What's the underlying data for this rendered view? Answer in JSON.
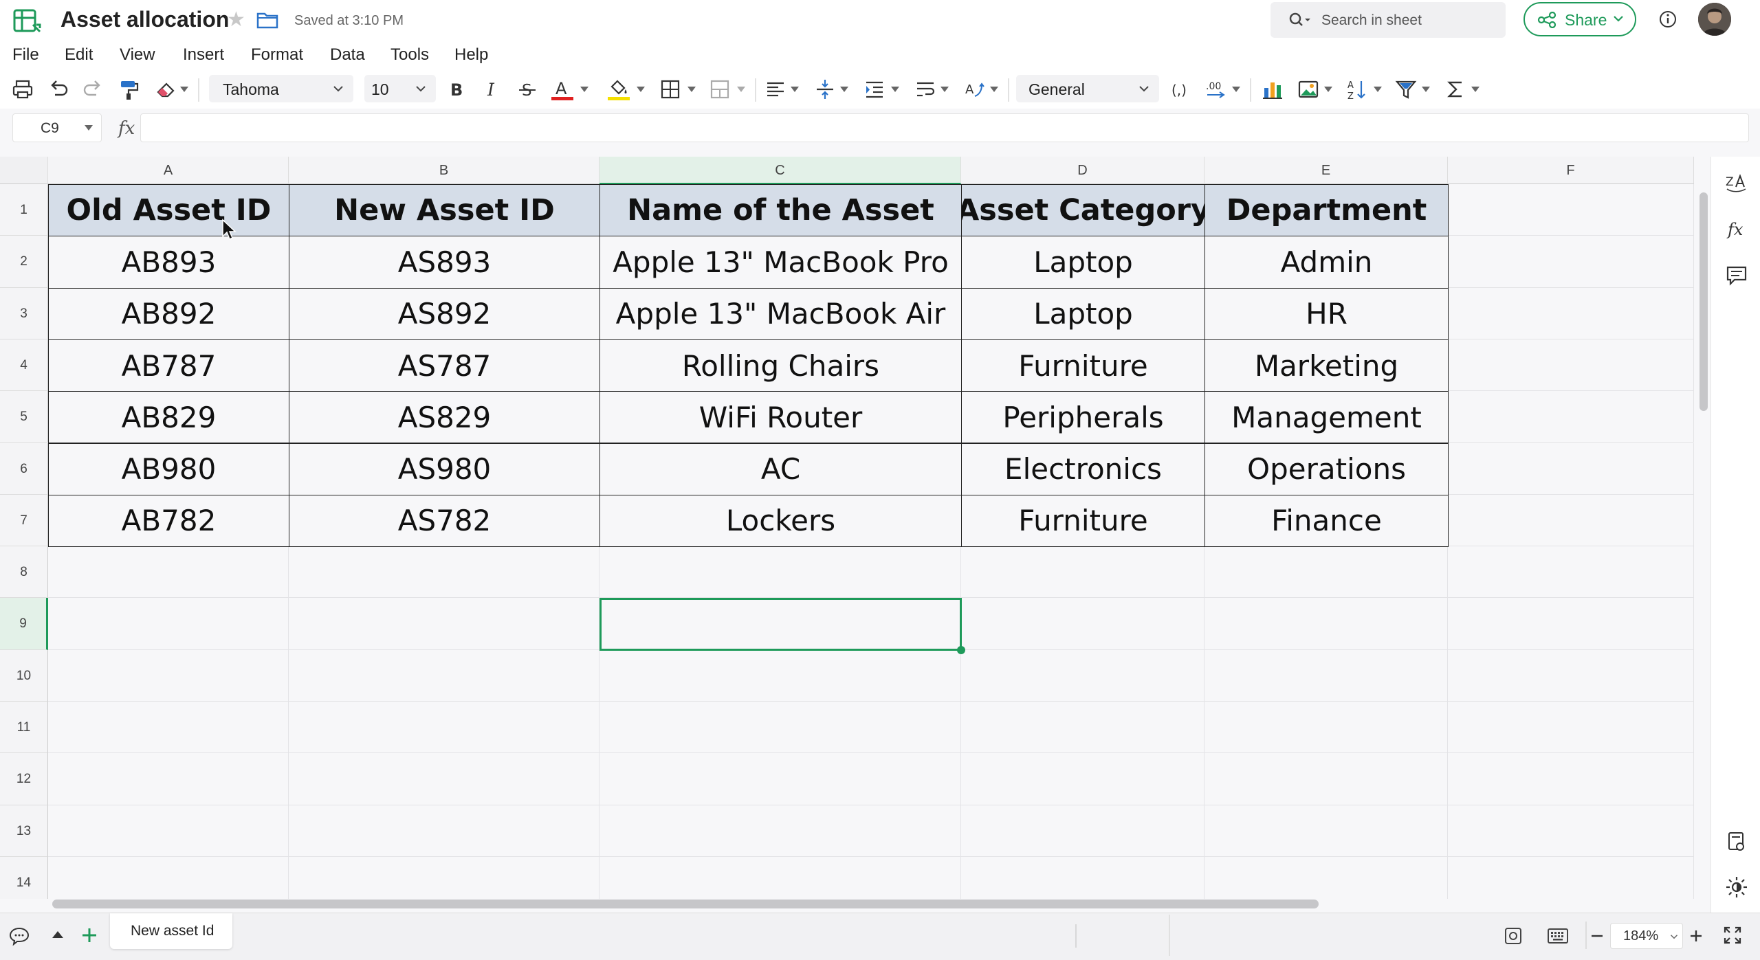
{
  "app": {
    "doc_title": "Asset allocation",
    "saved_status": "Saved at 3:10 PM",
    "search_placeholder": "Search in sheet",
    "share_label": "Share",
    "accent_color": "#1e9a5a"
  },
  "menu": [
    "File",
    "Edit",
    "View",
    "Insert",
    "Format",
    "Data",
    "Tools",
    "Help"
  ],
  "toolbar": {
    "font_family": "Tahoma",
    "font_size": "10",
    "number_format": "General",
    "font_color": "#e02020",
    "fill_color": "#f5e000",
    "icons": [
      "print-icon",
      "undo-icon",
      "redo-icon",
      "paint-format-icon",
      "eraser-icon",
      "bold-icon",
      "italic-icon",
      "strikethrough-icon",
      "font-color-icon",
      "fill-color-icon",
      "borders-icon",
      "merge-cells-icon",
      "align-horizontal-icon",
      "align-vertical-icon",
      "indent-icon",
      "wrap-text-icon",
      "text-rotation-icon",
      "thousands-separator-icon",
      "decimal-places-icon",
      "chart-icon",
      "image-icon",
      "sort-icon",
      "filter-icon",
      "sum-icon"
    ]
  },
  "formula_bar": {
    "cell_ref": "C9",
    "fx_label": "fx",
    "value": ""
  },
  "sheet": {
    "columns": [
      "A",
      "B",
      "C",
      "D",
      "E",
      "F"
    ],
    "rows": [
      "1",
      "2",
      "3",
      "4",
      "5",
      "6",
      "7",
      "8",
      "9",
      "10",
      "11",
      "12",
      "13",
      "14"
    ],
    "selected_cell": "C9",
    "header": [
      "Old Asset ID",
      "New Asset ID",
      "Name of the Asset",
      "Asset Category",
      "Department"
    ],
    "data": [
      [
        "AB893",
        "AS893",
        "Apple 13\" MacBook Pro",
        "Laptop",
        "Admin"
      ],
      [
        "AB892",
        "AS892",
        "Apple 13\" MacBook Air",
        "Laptop",
        "HR"
      ],
      [
        "AB787",
        "AS787",
        "Rolling Chairs",
        "Furniture",
        "Marketing"
      ],
      [
        "AB829",
        "AS829",
        "WiFi Router",
        "Peripherals",
        "Management"
      ],
      [
        "AB980",
        "AS980",
        "AC",
        "Electronics",
        "Operations"
      ],
      [
        "AB782",
        "AS782",
        "Lockers",
        "Furniture",
        "Finance"
      ]
    ],
    "header_fill": "#d5dde8"
  },
  "footer": {
    "sheet_tab": "New asset Id",
    "zoom": "184%"
  }
}
